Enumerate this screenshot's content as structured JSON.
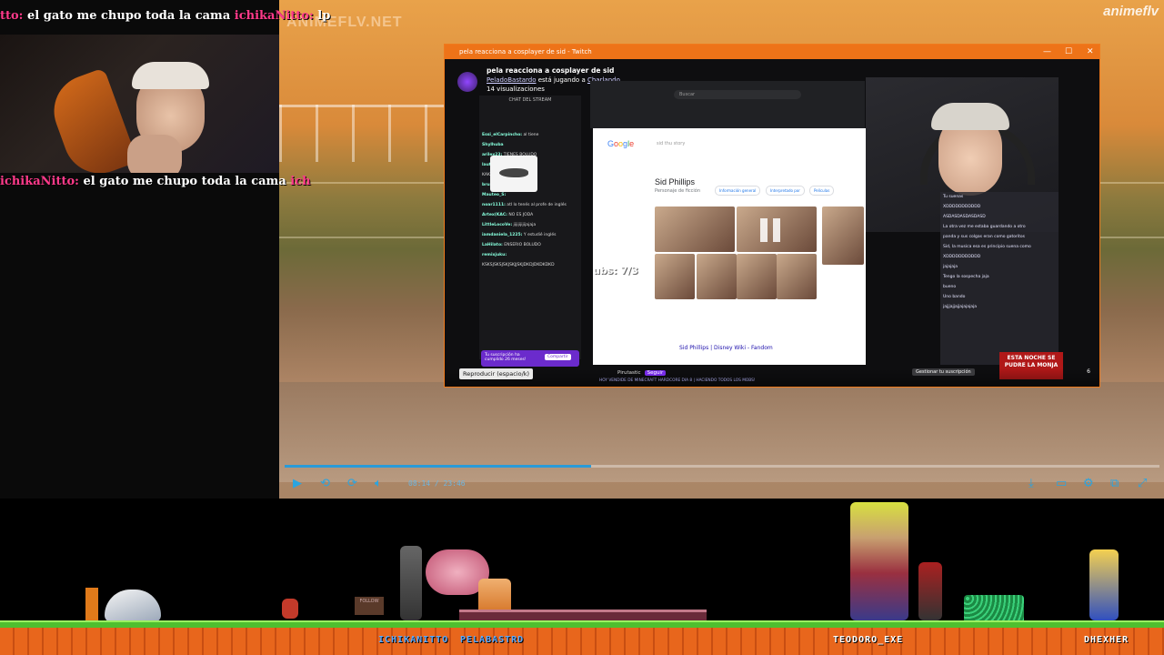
{
  "overlay": {
    "marquee_top": {
      "pre": "tto:",
      "msg1": " el gato me chupo toda la cama ",
      "user": "ichikaNitto:",
      "msg2": " lp"
    },
    "marquee_mid": {
      "pre": "ichikaNitto:",
      "msg1": " el gato me chupo toda la cama ",
      "user": "ich"
    }
  },
  "anime_player": {
    "watermark_left": "ANIMEFLV.NET",
    "watermark_right": "animeflv",
    "time": "08:14 / 23:46",
    "progress": 0.35,
    "icons": [
      "play-icon",
      "rewind-icon",
      "forward-icon",
      "volume-icon",
      "download-icon",
      "subtitles-icon",
      "settings-icon",
      "pip-icon",
      "fullscreen-icon"
    ]
  },
  "twitch_window": {
    "title": "pela reacciona a cosplayer de sid - Twitch",
    "controls": {
      "min": "—",
      "max": "☐",
      "close": "✕"
    },
    "stream_title": "pela reacciona a cosplayer de sid",
    "streamer_line_a": "PeladoBastardo",
    "streamer_line_b": " está jugando a ",
    "category": "Charlando",
    "views": "14 visualizaciones",
    "chat_header": "CHAT DEL STREAM",
    "chat_lines": [
      {
        "u": "Essi_elCarpincho:",
        "m": " al tiene"
      },
      {
        "u": "Shylhuba",
        "m": ""
      },
      {
        "u": "arilex23:",
        "m": " TIENES BOLUDO"
      },
      {
        "u": "lautic_camilo_dxe:",
        "m": ""
      },
      {
        "u": "",
        "m": "KAKAKAJAKAJAKSAJAJSJ"
      },
      {
        "u": "bruperrtaelc:",
        "m": " jijajajaka"
      },
      {
        "u": "Mauteo_S:",
        "m": ""
      },
      {
        "u": "noar1111:",
        "m": " atl lo tenés al profe de inglés"
      },
      {
        "u": "Artex(KAC:",
        "m": " NO ES JODA"
      },
      {
        "u": "LittleLocoVe:",
        "m": " jijijijijijajaja"
      },
      {
        "u": "iamdaniela_1225:",
        "m": " Y estudié inglés"
      },
      {
        "u": "LaHilato:",
        "m": " ENSERIO BOLUDO"
      },
      {
        "u": "remixjuku:",
        "m": ""
      },
      {
        "u": "",
        "m": "KSKSJSKSJSKJSKJJSKJDKDJDKDKDKD"
      }
    ],
    "sub_notice": "Tu suscripción ha cumplido 26 meses!",
    "share_btn": "Compartir",
    "browser_search": "Buscar",
    "google_query": "sid thu story",
    "google_title": "Sid Phillips",
    "google_subtitle": "Personaje de ficción",
    "google_chips": [
      "Información general",
      "Interpretado por",
      "Películas"
    ],
    "google_link": "Sid Phillips | Disney Wiki - Fandom",
    "overlay_text": "ubs: 7/3",
    "right_chat": [
      {
        "u": "",
        "m": "Tu suenas"
      },
      {
        "u": "",
        "m": "XDDDDDDDDDDD"
      },
      {
        "u": "",
        "m": "ASDASDASDASDASD"
      },
      {
        "u": "",
        "m": "La otra vez me estaba guardando a otro"
      },
      {
        "u": "",
        "m": "panda y sus colgas eran como gatoritos"
      },
      {
        "u": "",
        "m": "Sid, la musica esa es principio suena como"
      },
      {
        "u": "",
        "m": "XDDDDDDDDDDD"
      },
      {
        "u": "",
        "m": "jajajaja"
      },
      {
        "u": "",
        "m": "Tengo la sospecha jaja"
      },
      {
        "u": "",
        "m": "bueno"
      },
      {
        "u": "",
        "m": "Uno bando"
      },
      {
        "u": "",
        "m": "jajjjajjajjajajajaja"
      }
    ],
    "esta_noche": "ESTA NOCHE SE PUDRE LA MONJA",
    "tooltip": "Reproducir (espacio/k)",
    "streamer_name": "Pirutastic",
    "follow_label": "Seguir",
    "ticker": "HOY VENDIDE DE MINECRAFT HARDCORE DIA 8 | HACIENDO TODOS LOS MOBS!",
    "manage_sub": "Gestionar tu suscripción",
    "viewer_count": "6"
  },
  "game": {
    "sign": "FOLLOW",
    "players": [
      {
        "name": "ICHIKANITTO",
        "accent": true
      },
      {
        "name": "PELABASTRD",
        "accent": true
      },
      {
        "name": "TEODORO_EXE",
        "accent": false
      },
      {
        "name": "DHEXHER",
        "accent": false
      }
    ]
  },
  "colors": {
    "accent": "#ee7318",
    "twitch": "#772ce8",
    "player_blue": "#2aa4e0",
    "marquee_user": "#ff3a8a"
  }
}
